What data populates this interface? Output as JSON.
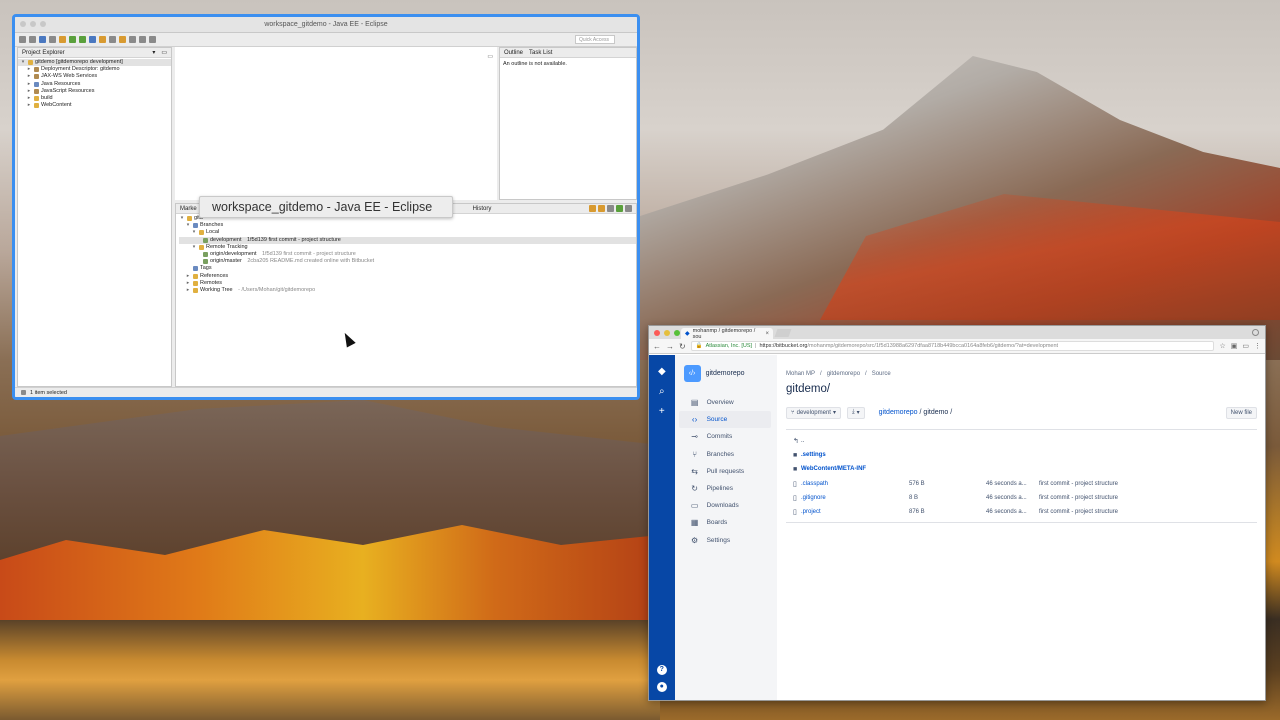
{
  "eclipse": {
    "title": "workspace_gitdemo - Java EE - Eclipse",
    "quick_access": "Quick Access",
    "project_explorer": {
      "tab": "Project Explorer",
      "items": [
        {
          "label": "gitdemo [gitdemorepo development]",
          "indent": 0,
          "twisty": "▾"
        },
        {
          "label": "Deployment Descriptor: gitdemo",
          "indent": 1,
          "twisty": "▸"
        },
        {
          "label": "JAX-WS Web Services",
          "indent": 1,
          "twisty": "▸"
        },
        {
          "label": "Java Resources",
          "indent": 1,
          "twisty": "▸"
        },
        {
          "label": "JavaScript Resources",
          "indent": 1,
          "twisty": "▸"
        },
        {
          "label": "build",
          "indent": 1,
          "twisty": "▸"
        },
        {
          "label": "WebContent",
          "indent": 1,
          "twisty": "▸"
        }
      ]
    },
    "outline": {
      "tab_outline": "Outline",
      "tab_tasks": "Task List",
      "message": "An outline is not available."
    },
    "bottom_tabs": {
      "markers": "Marke",
      "history": "History"
    },
    "git_repos": {
      "root": "gitd",
      "branches": "Branches",
      "local": "Local",
      "local_branch": "development",
      "local_branch_info": "1f5d139 first commit - project structure",
      "remote_tracking": "Remote Tracking",
      "remote_dev": "origin/development",
      "remote_dev_info": "1f5d139 first commit - project structure",
      "remote_master": "origin/master",
      "remote_master_info": "2cba205 README.md created online with Bitbucket",
      "tags": "Tags",
      "references": "References",
      "remotes": "Remotes",
      "working_tree": "Working Tree",
      "working_tree_path": "- /Users/Mohan/git/gitdemorepo"
    },
    "status": "1 item selected",
    "tooltip": "workspace_gitdemo - Java EE - Eclipse"
  },
  "browser": {
    "tab_title": "mohanmp / gitdemorepo / sou",
    "security_label": "Atlassian, Inc. [US]",
    "url_base": "https://bitbucket.org",
    "url_path": "/mohanmp/gitdemorepo/src/1f5d13988a6297dfaa8718b449bcca0164a8feb6/gitdemo/?at=development"
  },
  "bitbucket": {
    "repo_name": "gitdemorepo",
    "nav": [
      {
        "label": "Overview",
        "icon": "▤",
        "name": "overview"
      },
      {
        "label": "Source",
        "icon": "‹›",
        "name": "source",
        "active": true
      },
      {
        "label": "Commits",
        "icon": "⊸",
        "name": "commits"
      },
      {
        "label": "Branches",
        "icon": "⑂",
        "name": "branches"
      },
      {
        "label": "Pull requests",
        "icon": "⇆",
        "name": "pull-requests"
      },
      {
        "label": "Pipelines",
        "icon": "↻",
        "name": "pipelines"
      },
      {
        "label": "Downloads",
        "icon": "▭",
        "name": "downloads"
      },
      {
        "label": "Boards",
        "icon": "▦",
        "name": "boards"
      },
      {
        "label": "Settings",
        "icon": "⚙",
        "name": "settings"
      }
    ],
    "breadcrumbs": [
      "Mohan MP",
      "/",
      "gitdemorepo",
      "/",
      "Source"
    ],
    "page_title": "gitdemo/",
    "branch_button": "development",
    "path_repo": "gitdemorepo",
    "path_rest": "/ gitdemo /",
    "new_file": "New file",
    "files": [
      {
        "icon": "↰",
        "name": "..",
        "size": "",
        "date": "",
        "msg": "",
        "dir": false,
        "up": true
      },
      {
        "icon": "■",
        "name": ".settings",
        "size": "",
        "date": "",
        "msg": "",
        "dir": true
      },
      {
        "icon": "■",
        "name": "WebContent/META-INF",
        "size": "",
        "date": "",
        "msg": "",
        "dir": true
      },
      {
        "icon": "▯",
        "name": ".classpath",
        "size": "576 B",
        "date": "46 seconds a...",
        "msg": "first commit - project structure",
        "dir": false
      },
      {
        "icon": "▯",
        "name": ".gitignore",
        "size": "8 B",
        "date": "46 seconds a...",
        "msg": "first commit - project structure",
        "dir": false
      },
      {
        "icon": "▯",
        "name": ".project",
        "size": "876 B",
        "date": "46 seconds a...",
        "msg": "first commit - project structure",
        "dir": false
      }
    ]
  }
}
